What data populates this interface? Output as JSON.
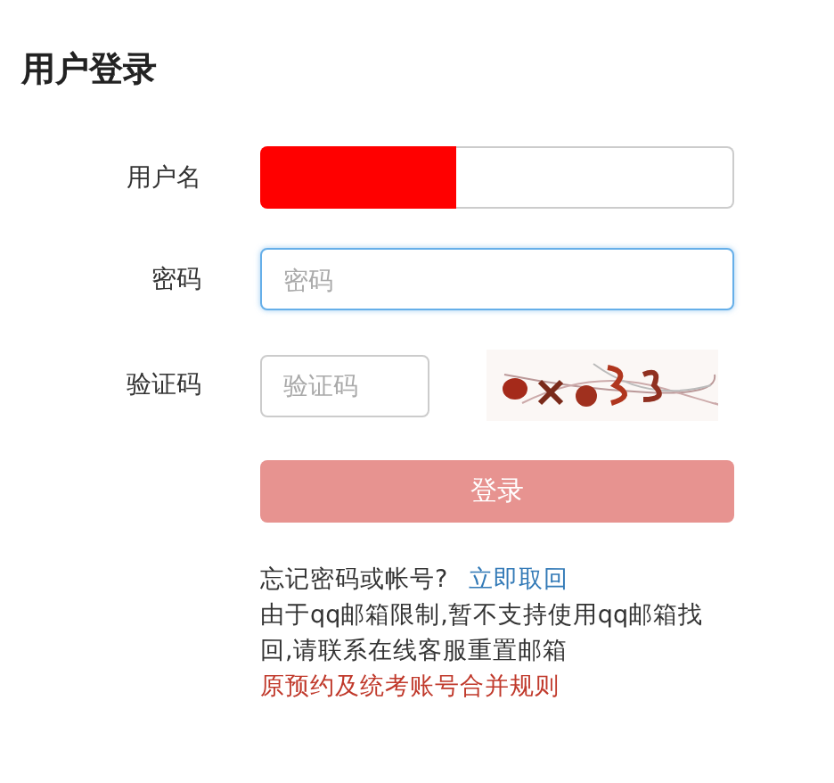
{
  "title": "用户登录",
  "fields": [
    {
      "kind": "text",
      "label": "用户名",
      "redacted": true,
      "focused": false
    },
    {
      "kind": "password",
      "label": "密码",
      "placeholder": "密码",
      "focused": true
    },
    {
      "kind": "captcha",
      "label": "验证码",
      "placeholder": "验证码",
      "focused": false
    }
  ],
  "login_button": {
    "label": "登录",
    "disabled": true
  },
  "forgot": {
    "text": "忘记密码或帐号?",
    "link": "立即取回"
  },
  "notice": "由于qq邮箱限制,暂不支持使用qq邮箱找回,请联系在线客服重置邮箱",
  "rules_link": "原预约及统考账号合并规则"
}
